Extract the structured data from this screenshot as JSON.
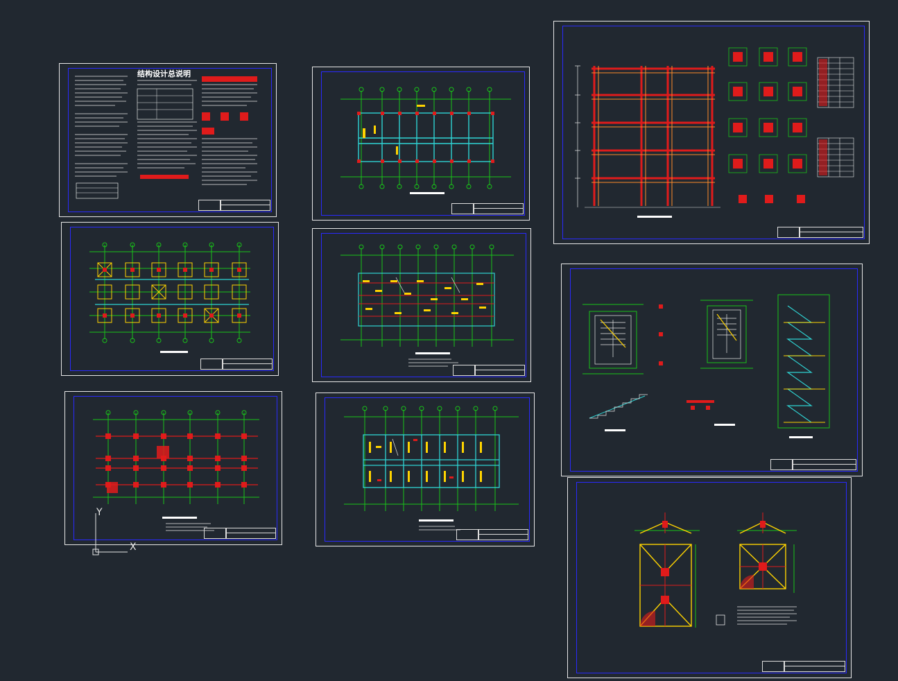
{
  "cover_sheet": {
    "title": "结构设计总说明"
  },
  "ucs": {
    "y_label": "Y",
    "x_label": "X"
  },
  "colors": {
    "background": "#212830",
    "sheet_border": "#e8e8e8",
    "inner_border": "#2a2aff",
    "axis_green": "#19c319",
    "beam_red": "#e01b1b",
    "cyan": "#2fd4d4",
    "yellow": "#ffd400"
  }
}
